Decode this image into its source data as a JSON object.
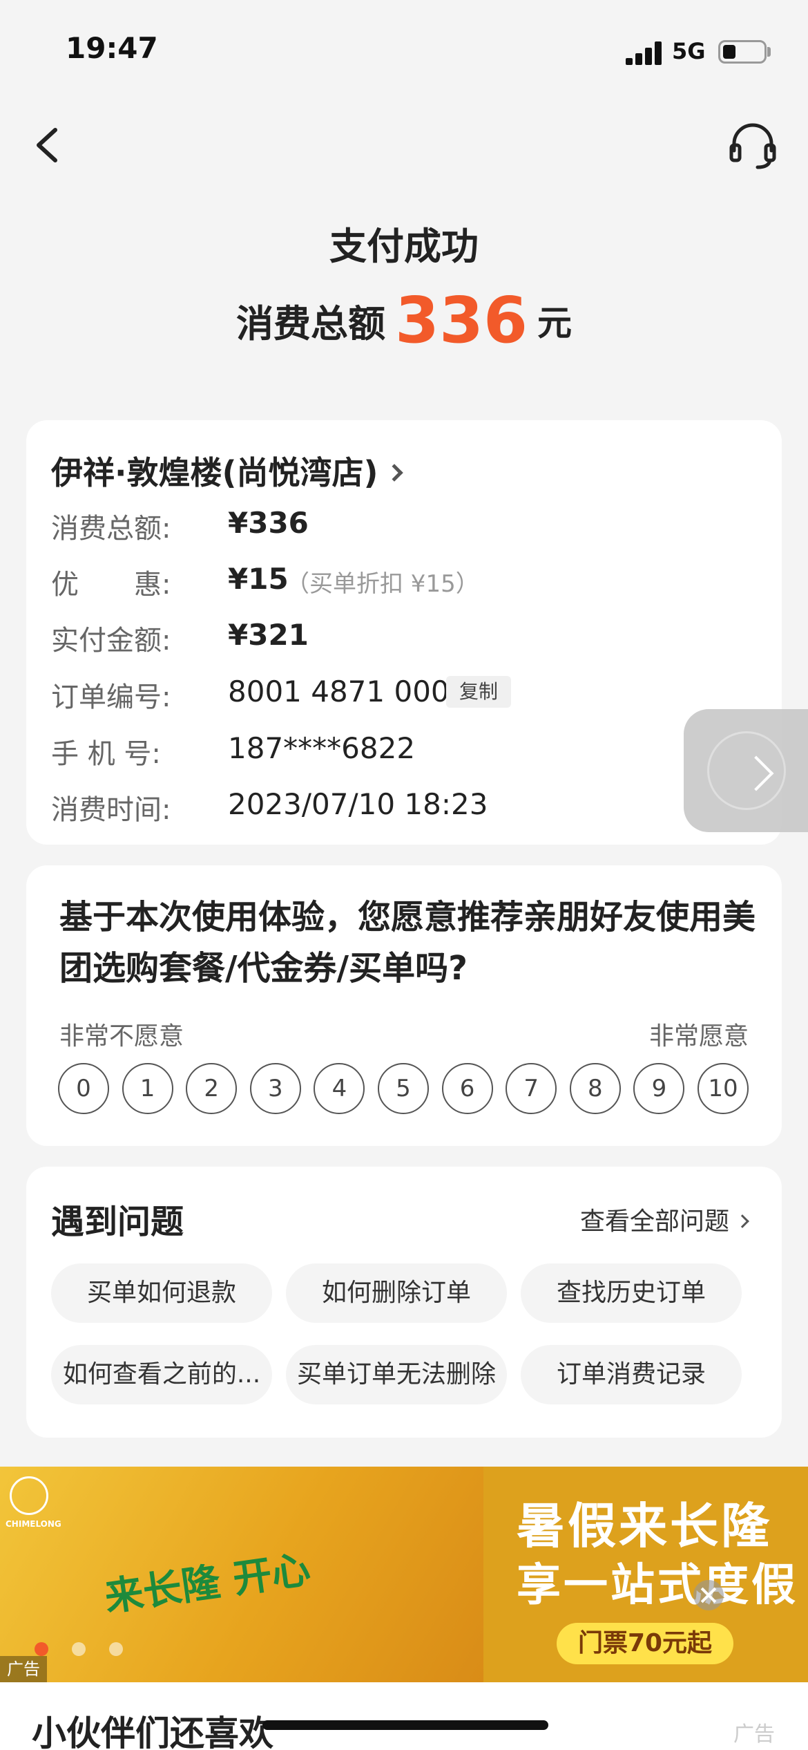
{
  "status_bar": {
    "time": "19:47",
    "network": "5G"
  },
  "header": {
    "title": "支付成功",
    "total_label": "消费总额",
    "total_amount": "336",
    "total_unit": "元"
  },
  "order": {
    "store_name": "伊祥·敦煌楼(尚悦湾店)",
    "rows": [
      {
        "label": "消费总额:",
        "value": "¥336"
      },
      {
        "label": "优　　惠:",
        "value": "¥15",
        "note": "（买单折扣 ¥15）"
      },
      {
        "label": "实付金额:",
        "value": "¥321"
      },
      {
        "label": "订单编号:",
        "value": "8001 4871 000",
        "action": "复制"
      },
      {
        "label": "手 机 号:",
        "value": "187****6822"
      },
      {
        "label": "消费时间:",
        "value": "2023/07/10 18:23"
      }
    ]
  },
  "survey": {
    "question": "基于本次使用体验，您愿意推荐亲朋好友使用美团选购套餐/代金券/买单吗?",
    "scale_low": "非常不愿意",
    "scale_high": "非常愿意",
    "scores": [
      "0",
      "1",
      "2",
      "3",
      "4",
      "5",
      "6",
      "7",
      "8",
      "9",
      "10"
    ]
  },
  "faq": {
    "title": "遇到问题",
    "view_all": "查看全部问题",
    "items": [
      "买单如何退款",
      "如何删除订单",
      "查找历史订单",
      "如何查看之前的...",
      "买单订单无法删除",
      "订单消费记录"
    ]
  },
  "ad": {
    "logo_text": "CHIMELONG",
    "cartoon_text": "来长隆 开心",
    "headline_1": "暑假来长隆",
    "headline_2": "享一站式度假",
    "cta": "门票70元起",
    "tag": "广告"
  },
  "recommend": {
    "title": "小伙伴们还喜欢",
    "ad_tag": "广告"
  },
  "colors": {
    "accent": "#f25a2a",
    "background": "#f4f4f4",
    "card": "#ffffff",
    "ad_yellow": "#e6b324"
  }
}
